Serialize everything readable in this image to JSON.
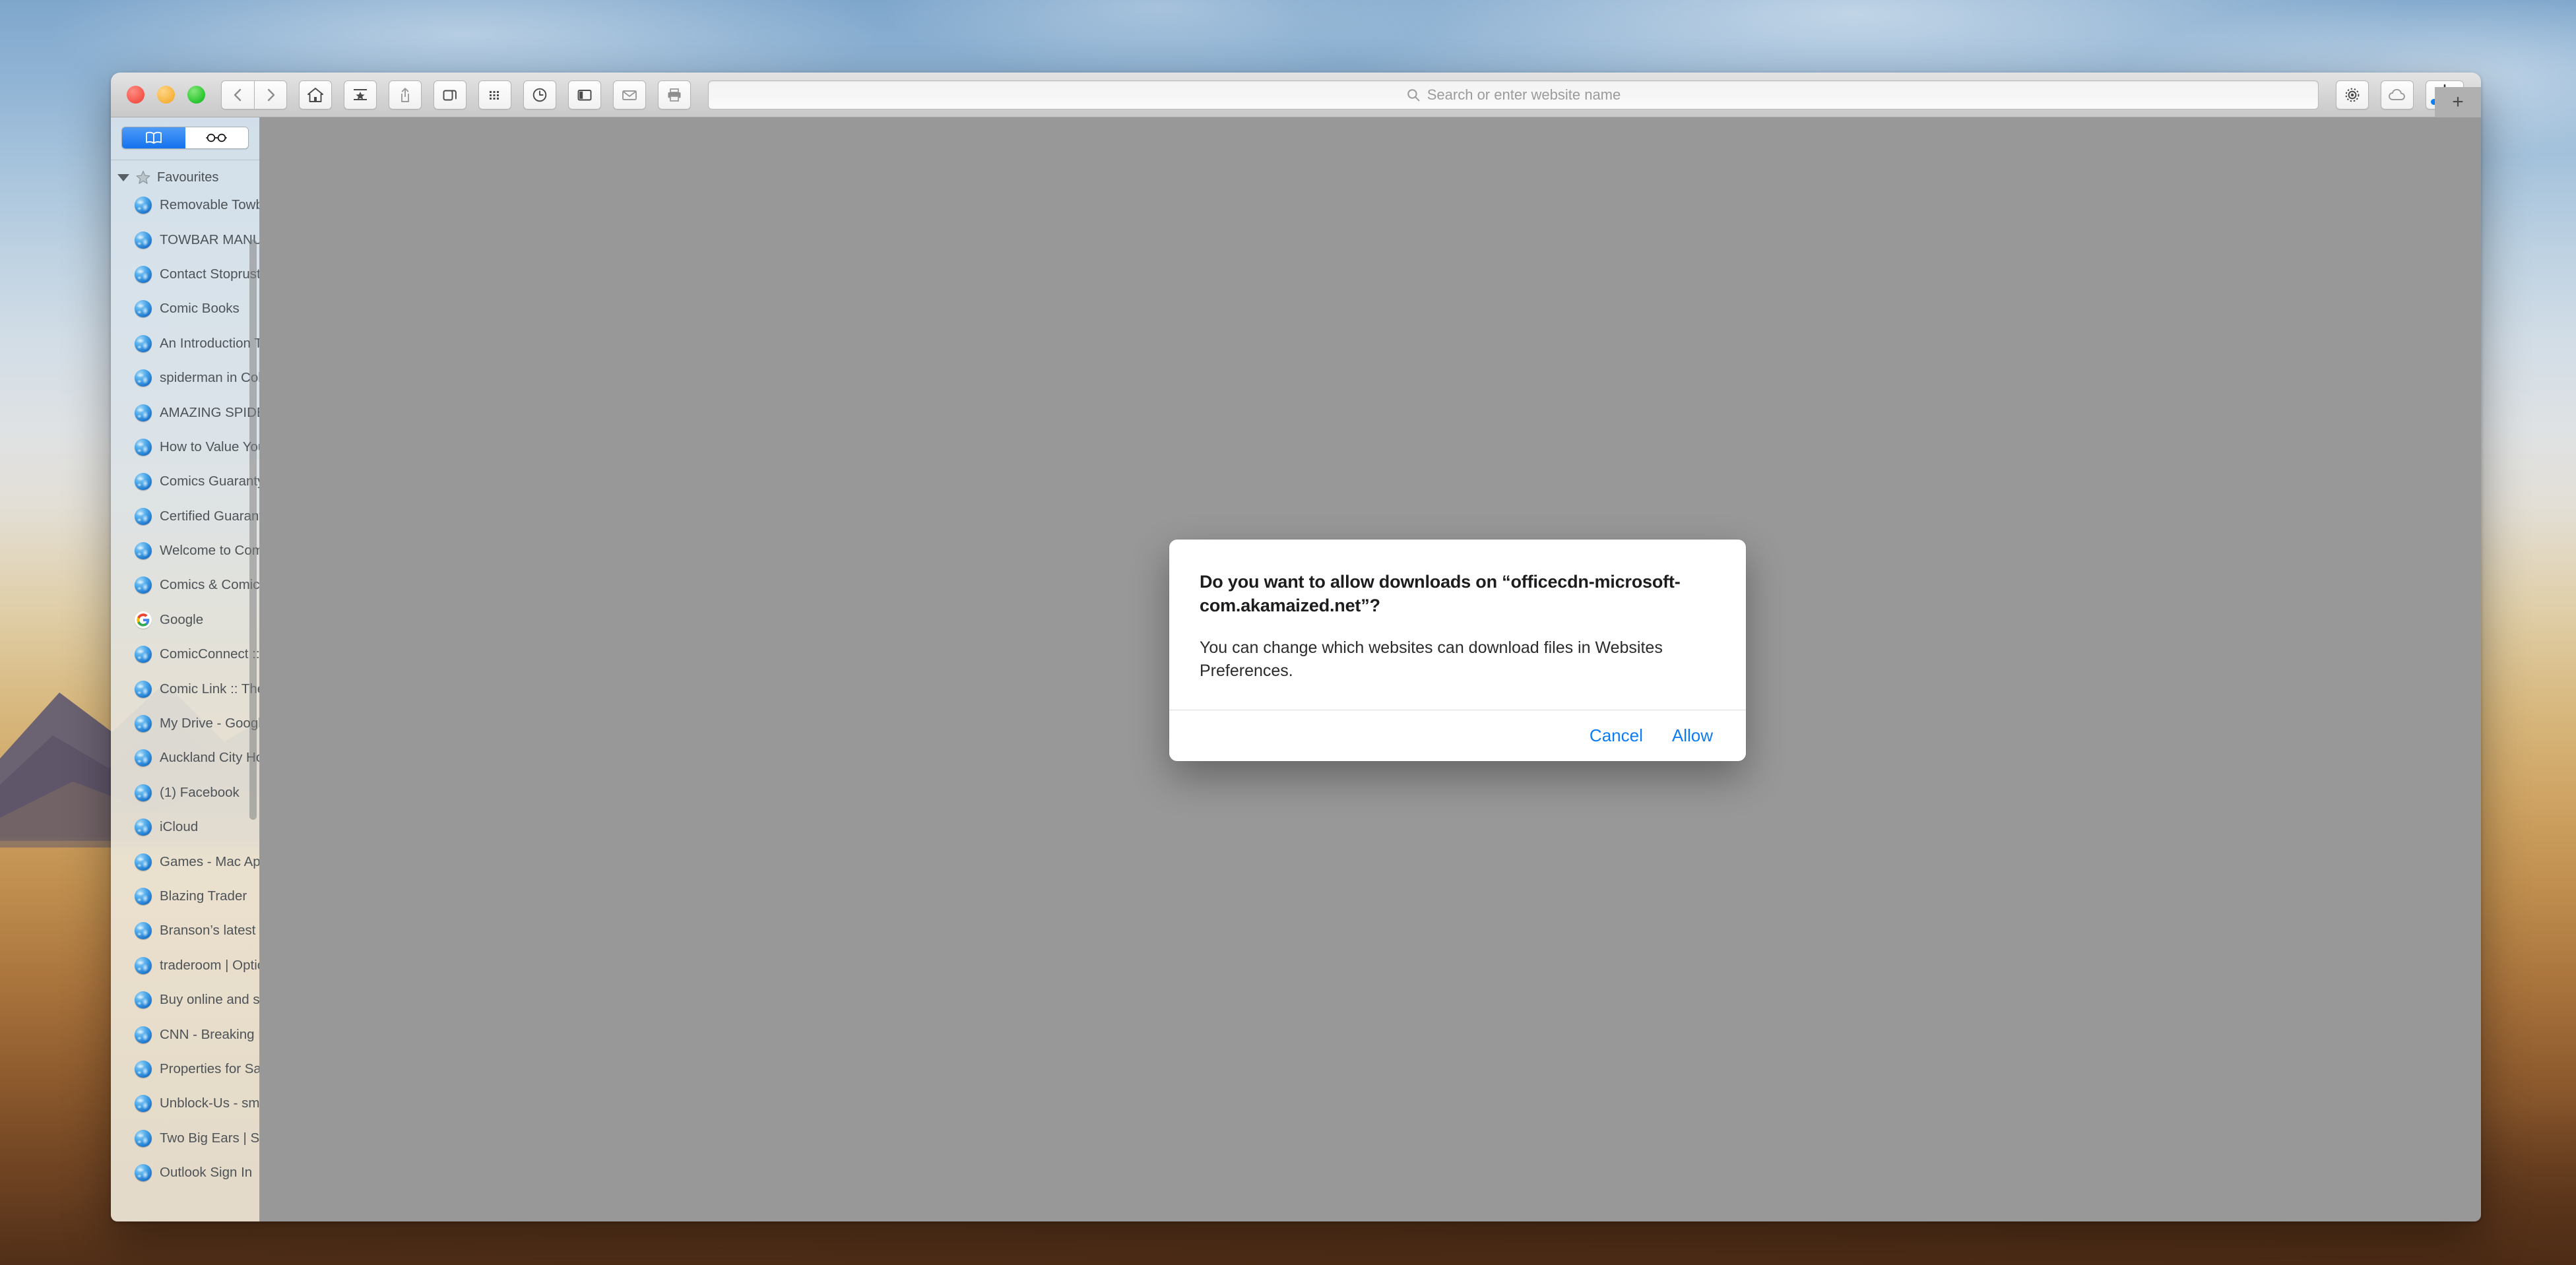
{
  "window": {
    "traffic_lights": [
      "close",
      "minimize",
      "zoom"
    ],
    "new_tab_label": "+"
  },
  "toolbar": {
    "back_label": "Back",
    "forward_label": "Forward",
    "home_label": "Home",
    "bookmarks_label": "Show bookmarks",
    "share_label": "Share",
    "tab_overview_label": "Tab overview",
    "top_sites_label": "Top Sites",
    "history_label": "History",
    "sidebar_label": "Sidebar",
    "mail_label": "Mail this page",
    "print_label": "Print",
    "settings_label": "Settings",
    "icloud_tabs_label": "iCloud Tabs",
    "downloads_label": "Downloads"
  },
  "address_bar": {
    "placeholder": "Search or enter website name",
    "value": "",
    "icon": "search-icon"
  },
  "downloads": {
    "progress_percent": 100,
    "accent_color": "#0a7ff3"
  },
  "sidebar": {
    "tabs": [
      {
        "name": "bookmarks",
        "icon": "book-icon",
        "active": true
      },
      {
        "name": "reading-list",
        "icon": "glasses-icon",
        "active": false
      }
    ],
    "section": {
      "label": "Favourites",
      "icon": "star-icon",
      "expanded": true
    },
    "items": [
      {
        "label": "Removable Towbar for B...",
        "icon": "globe-favicon"
      },
      {
        "label": "TOWBAR MANUFACTUR...",
        "icon": "globe-favicon"
      },
      {
        "label": "Contact Stoprust & Tow...",
        "icon": "globe-favicon"
      },
      {
        "label": "Comic Books",
        "icon": "globe-favicon"
      },
      {
        "label": "An Introduction To Colle...",
        "icon": "globe-favicon"
      },
      {
        "label": "spiderman in Collectible...",
        "icon": "globe-favicon"
      },
      {
        "label": "AMAZING SPIDER-MAN...",
        "icon": "globe-favicon"
      },
      {
        "label": "How to Value Your Comi...",
        "icon": "globe-favicon"
      },
      {
        "label": "Comics Guaranty - Wiki...",
        "icon": "globe-favicon"
      },
      {
        "label": "Certified Guaranty Com...",
        "icon": "globe-favicon"
      },
      {
        "label": "Welcome to ComicsPric...",
        "icon": "globe-favicon"
      },
      {
        "label": "Comics & Comic Art | H...",
        "icon": "globe-favicon"
      },
      {
        "label": "Google",
        "icon": "google-favicon"
      },
      {
        "label": "ComicConnect :: The On...",
        "icon": "globe-favicon"
      },
      {
        "label": "Comic Link :: The Online...",
        "icon": "globe-favicon"
      },
      {
        "label": "My Drive - Google Drive",
        "icon": "globe-favicon"
      },
      {
        "label": "Auckland City Houses fo...",
        "icon": "globe-favicon"
      },
      {
        "label": "(1) Facebook",
        "icon": "globe-favicon"
      },
      {
        "label": "iCloud",
        "icon": "globe-favicon"
      },
      {
        "label": "Games - Mac App Store...",
        "icon": "globe-favicon"
      },
      {
        "label": "Blazing Trader",
        "icon": "globe-favicon"
      },
      {
        "label": "Branson’s latest leaked i...",
        "icon": "globe-favicon"
      },
      {
        "label": "traderoom | OptionBit™",
        "icon": "globe-favicon"
      },
      {
        "label": "Buy online and sell with...",
        "icon": "globe-favicon"
      },
      {
        "label": "CNN - Breaking News, U...",
        "icon": "globe-favicon"
      },
      {
        "label": "Properties for Sale - real...",
        "icon": "globe-favicon"
      },
      {
        "label": "Unblock-Us - smarter fa...",
        "icon": "globe-favicon"
      },
      {
        "label": "Two Big Ears | Smile! Yo...",
        "icon": "globe-favicon"
      },
      {
        "label": "Outlook Sign In",
        "icon": "globe-favicon"
      }
    ]
  },
  "dialog": {
    "title": "Do you want to allow downloads on “officecdn-microsoft-com.akamaized.net”?",
    "message": "You can change which websites can download files in Websites Preferences.",
    "cancel_label": "Cancel",
    "allow_label": "Allow",
    "button_color": "#0a7cf7"
  }
}
